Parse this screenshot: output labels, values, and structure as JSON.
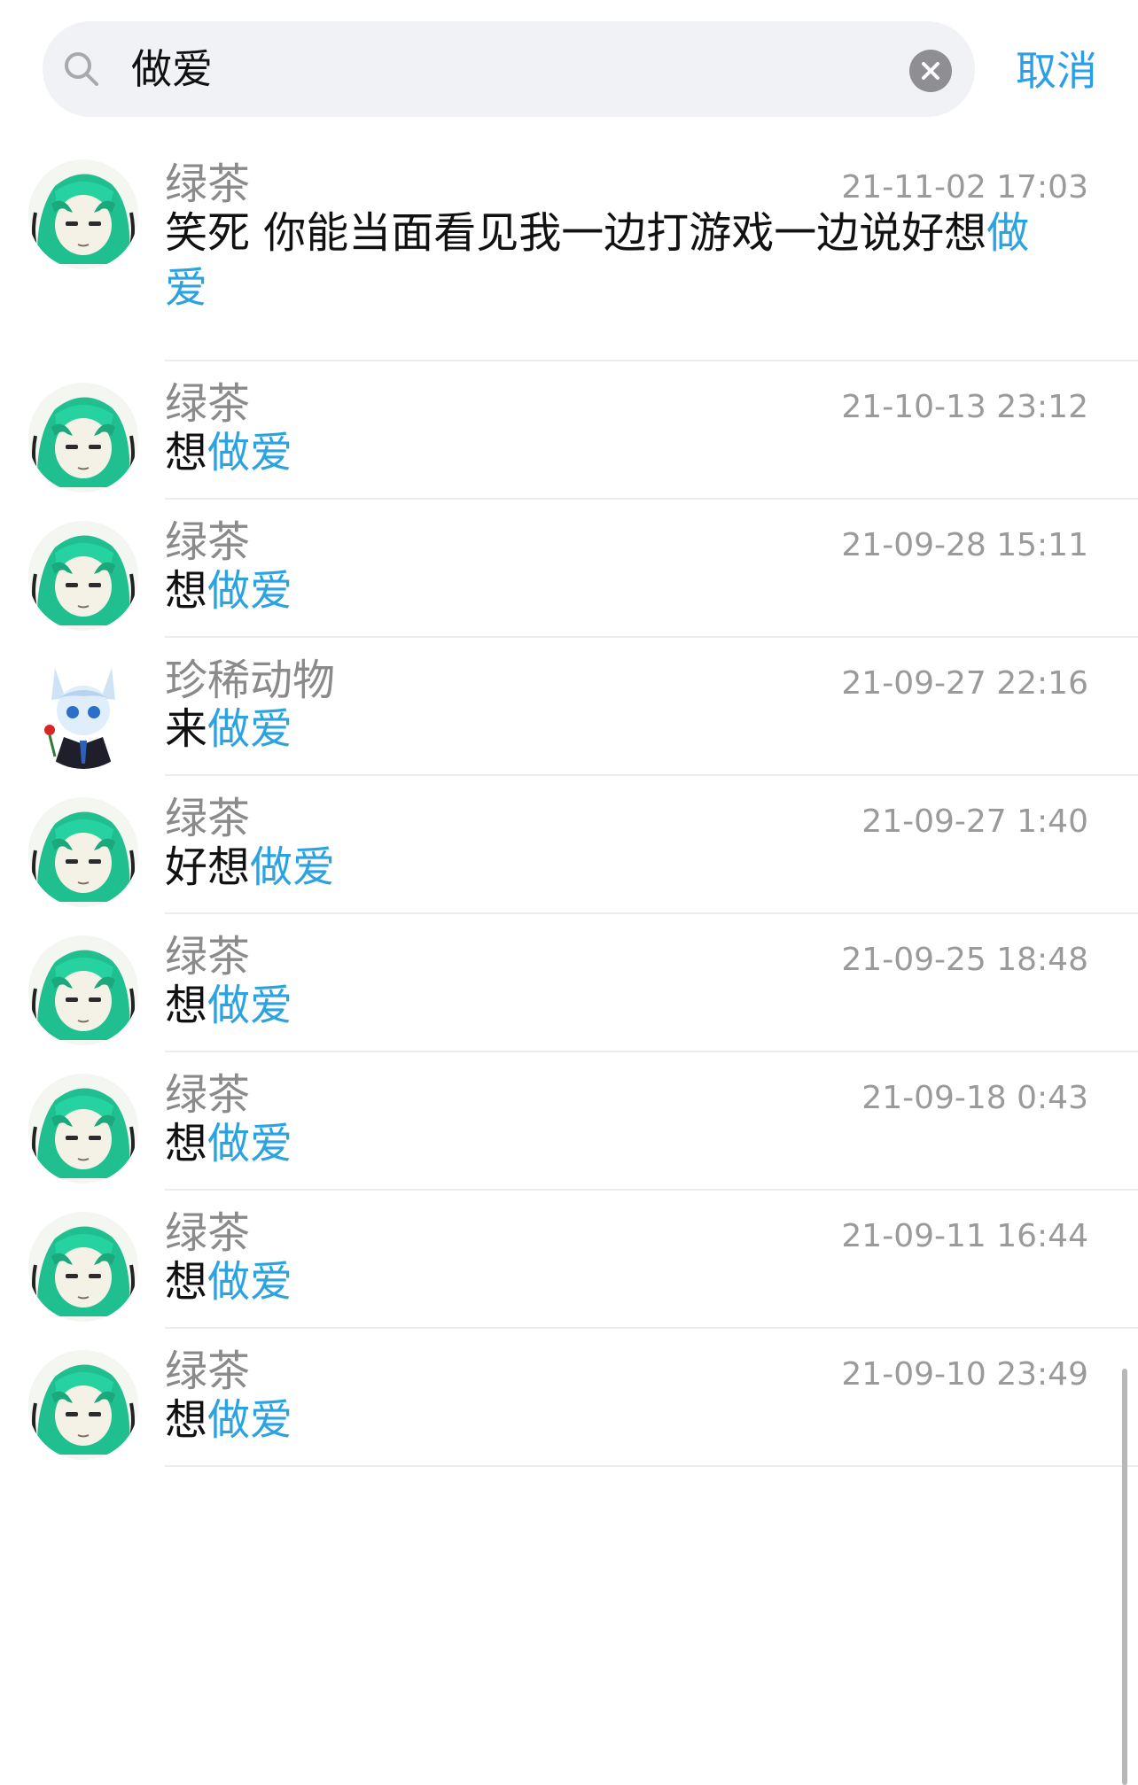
{
  "search": {
    "query": "做爱",
    "cancel_label": "取消"
  },
  "results": [
    {
      "name": "绿茶",
      "time": "21-11-02 17:03",
      "pre": "笑死 你能当面看见我一边打游戏一边说好想",
      "match": "做爱",
      "avatar": "green-hair-avatar"
    },
    {
      "name": "绿茶",
      "time": "21-10-13 23:12",
      "pre": "想",
      "match": "做爱",
      "avatar": "green-hair-avatar"
    },
    {
      "name": "绿茶",
      "time": "21-09-28 15:11",
      "pre": "想",
      "match": "做爱",
      "avatar": "green-hair-avatar"
    },
    {
      "name": "珍稀动物",
      "time": "21-09-27 22:16",
      "pre": "来",
      "match": "做爱",
      "avatar": "fox-boy-avatar"
    },
    {
      "name": "绿茶",
      "time": "21-09-27 1:40",
      "pre": "好想",
      "match": "做爱",
      "avatar": "green-hair-avatar"
    },
    {
      "name": "绿茶",
      "time": "21-09-25 18:48",
      "pre": "想",
      "match": "做爱",
      "avatar": "green-hair-avatar"
    },
    {
      "name": "绿茶",
      "time": "21-09-18 0:43",
      "pre": "想",
      "match": "做爱",
      "avatar": "green-hair-avatar"
    },
    {
      "name": "绿茶",
      "time": "21-09-11 16:44",
      "pre": "想",
      "match": "做爱",
      "avatar": "green-hair-avatar"
    },
    {
      "name": "绿茶",
      "time": "21-09-10 23:49",
      "pre": "想",
      "match": "做爱",
      "avatar": "green-hair-avatar"
    }
  ],
  "colors": {
    "accent": "#2a9ee6",
    "highlight": "#2ba3e2",
    "muted_text": "#8a8a8a",
    "search_bg": "#f1f2f6"
  }
}
